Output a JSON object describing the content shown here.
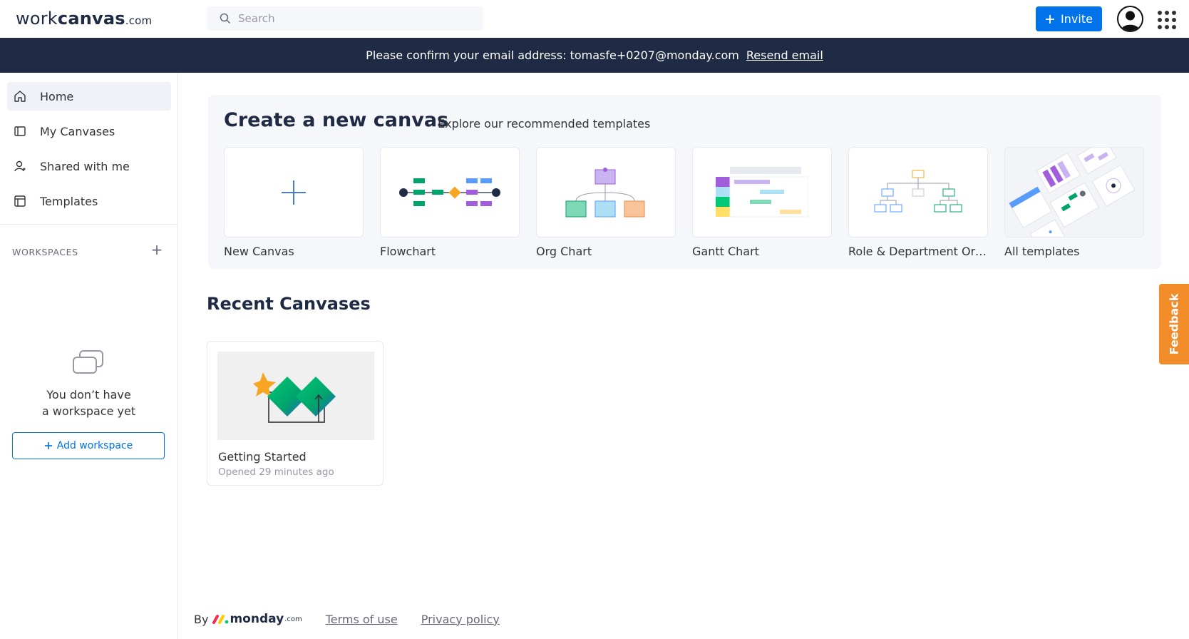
{
  "header": {
    "logo_prefix": "work",
    "logo_bold": "canvas",
    "logo_suffix": ".com",
    "search_placeholder": "Search",
    "invite_label": "Invite"
  },
  "banner": {
    "message": "Please confirm your email address: tomasfe+0207@monday.com",
    "link": "Resend email"
  },
  "sidebar": {
    "items": [
      {
        "label": "Home",
        "icon": "home-icon",
        "active": true
      },
      {
        "label": "My Canvases",
        "icon": "canvas-icon",
        "active": false
      },
      {
        "label": "Shared with me",
        "icon": "user-icon",
        "active": false
      },
      {
        "label": "Templates",
        "icon": "templates-icon",
        "active": false
      }
    ],
    "workspaces_title": "WORKSPACES",
    "empty_line1": "You don’t have",
    "empty_line2": "a workspace yet",
    "add_workspace": "Add workspace"
  },
  "create": {
    "title": "Create a new canvas",
    "subtitle": "Explore our recommended templates",
    "templates": [
      {
        "label": "New Canvas"
      },
      {
        "label": "Flowchart"
      },
      {
        "label": "Org Chart"
      },
      {
        "label": "Gantt Chart"
      },
      {
        "label": "Role & Department Org..."
      },
      {
        "label": "All templates"
      }
    ]
  },
  "recent": {
    "title": "Recent Canvases",
    "items": [
      {
        "name": "Getting Started",
        "meta": "Opened 29 minutes ago"
      }
    ]
  },
  "footer": {
    "by": "By",
    "brand": "monday",
    "brand_suffix": ".com",
    "terms": "Terms of use",
    "privacy": "Privacy policy"
  },
  "feedback": "Feedback",
  "colors": {
    "primary": "#0073ea",
    "banner": "#1f2a44",
    "feedback": "#f28c28"
  }
}
